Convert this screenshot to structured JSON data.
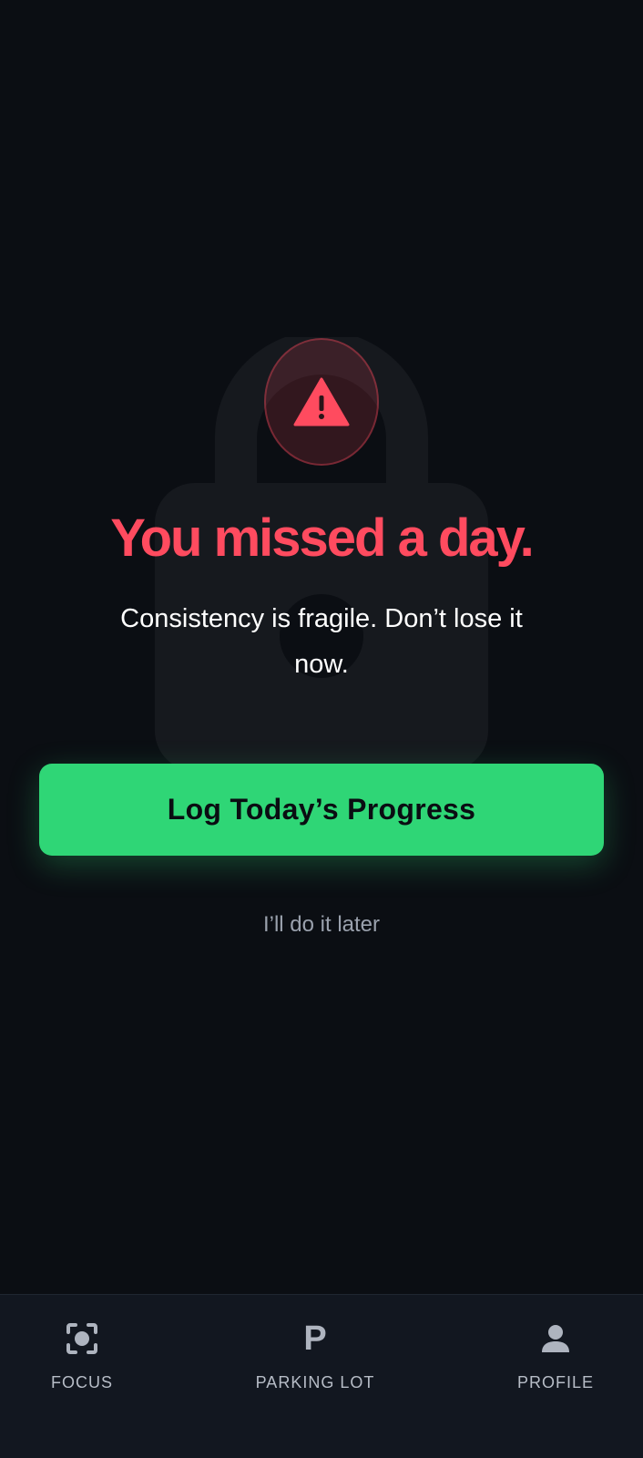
{
  "alert": {
    "title": "You missed a day.",
    "message": "Consistency is fragile. Don’t lose it now."
  },
  "actions": {
    "primary_label": "Log Today’s Progress",
    "secondary_label": "I’ll do it later"
  },
  "nav": {
    "items": [
      {
        "label": "FOCUS",
        "icon": "focus-icon"
      },
      {
        "label": "PARKING LOT",
        "icon": "parking-icon"
      },
      {
        "label": "PROFILE",
        "icon": "profile-icon"
      }
    ]
  },
  "colors": {
    "background": "#0b0e13",
    "accent_red": "#ff4b5f",
    "accent_green": "#2fd676",
    "nav_background": "#121720",
    "nav_text": "#b7bdc7"
  }
}
